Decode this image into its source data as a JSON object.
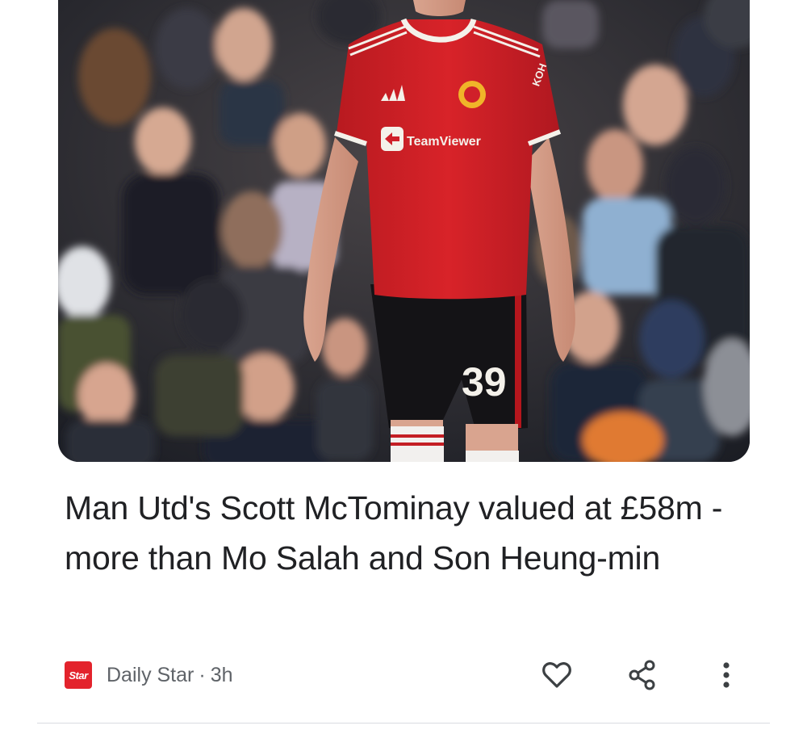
{
  "article": {
    "headline": "Man Utd's Scott McTominay valued at £58m - more than Mo Salah and Son Heung-min",
    "image": {
      "jersey_sponsor": "TeamViewer",
      "shirt_number": "39",
      "sleeve_text": "KOH"
    },
    "source": {
      "logo_text": "Star",
      "name": "Daily Star",
      "separator": "·",
      "time": "3h"
    }
  },
  "actions": {
    "like_icon": "heart-outline-icon",
    "share_icon": "share-icon",
    "more_icon": "more-vert-icon"
  },
  "colors": {
    "headline": "#202124",
    "meta": "#5f6368",
    "icon": "#3c4043",
    "logo_bg": "#e3232c",
    "jersey_red": "#d62229",
    "divider": "#dadce0"
  }
}
